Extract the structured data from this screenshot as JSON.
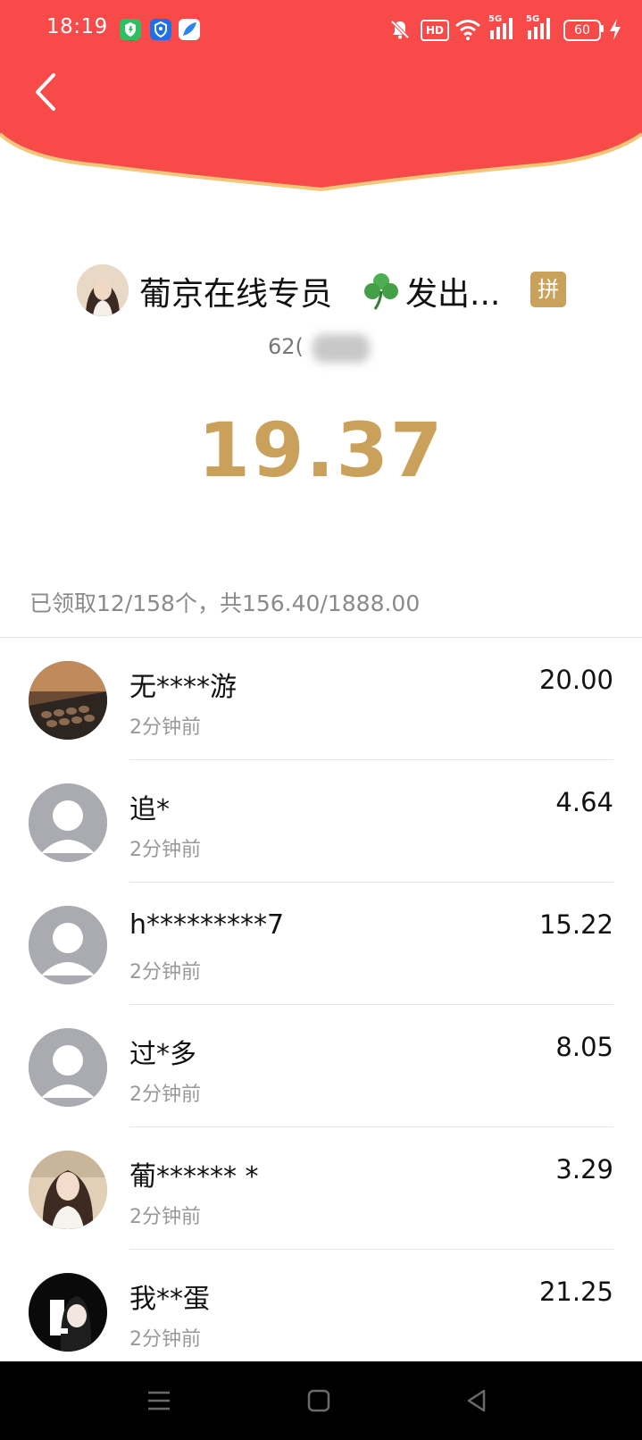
{
  "status_bar": {
    "time": "18:19",
    "battery": "60",
    "network_1": "5G",
    "network_2": "5G",
    "hd": "HD",
    "icons": [
      "shield-app-icon",
      "vpn-app-icon",
      "browser-app-icon",
      "mute-icon",
      "hd-icon",
      "wifi-icon",
      "signal-5g-icon",
      "signal-5g-icon",
      "battery-icon",
      "charging-icon"
    ]
  },
  "header": {
    "back_icon": "chevron-left-icon",
    "background_color": "#f94a4a",
    "border_color": "#f2c77a"
  },
  "sender": {
    "name": "葡京在线专员",
    "emoji": "clover-icon",
    "suffix": "发出...",
    "badge": "拼",
    "id_prefix": "62("
  },
  "amount": "19.37",
  "accent_color": "#c9a15a",
  "summary": "已领取12/158个，共156.40/1888.00",
  "claims": [
    {
      "name": "无****游",
      "time": "2分钟前",
      "amount": "20.00",
      "avatar": "photo-avatar"
    },
    {
      "name": "追*",
      "time": "2分钟前",
      "amount": "4.64",
      "avatar": "default-avatar"
    },
    {
      "name": "h*********7",
      "time": "2分钟前",
      "amount": "15.22",
      "avatar": "default-avatar"
    },
    {
      "name": "过*多",
      "time": "2分钟前",
      "amount": "8.05",
      "avatar": "default-avatar"
    },
    {
      "name": "葡****** *",
      "time": "2分钟前",
      "amount": "3.29",
      "avatar": "photo-avatar"
    },
    {
      "name": "我**蛋",
      "time": "2分钟前",
      "amount": "21.25",
      "avatar": "photo-avatar"
    }
  ],
  "nav": {
    "items": [
      "menu-icon",
      "home-icon",
      "back-icon"
    ]
  }
}
